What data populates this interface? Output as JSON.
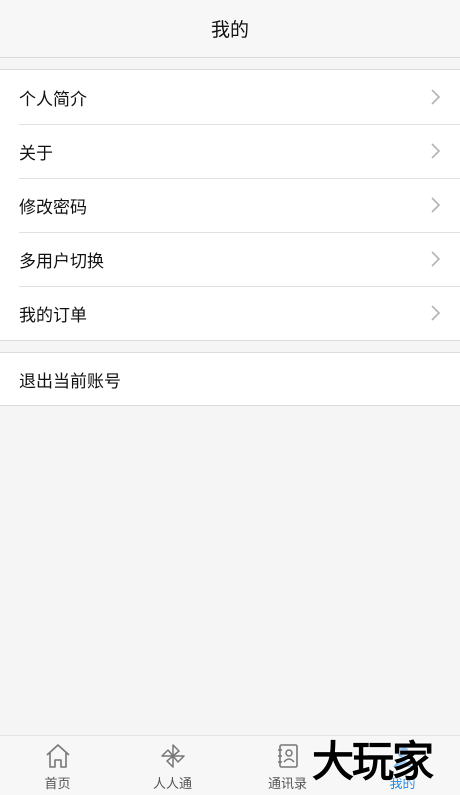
{
  "header": {
    "title": "我的"
  },
  "menu": {
    "items": [
      {
        "label": "个人简介"
      },
      {
        "label": "关于"
      },
      {
        "label": "修改密码"
      },
      {
        "label": "多用户切换"
      },
      {
        "label": "我的订单"
      }
    ],
    "logout_label": "退出当前账号"
  },
  "tabbar": {
    "tabs": [
      {
        "label": "首页",
        "icon": "home-icon"
      },
      {
        "label": "人人通",
        "icon": "pinwheel-icon"
      },
      {
        "label": "通讯录",
        "icon": "contacts-book-icon"
      },
      {
        "label": "我的",
        "icon": "user-icon"
      }
    ],
    "active_color": "#1e88e5",
    "inactive_color": "#555555"
  },
  "watermark": {
    "text": "大玩家"
  }
}
